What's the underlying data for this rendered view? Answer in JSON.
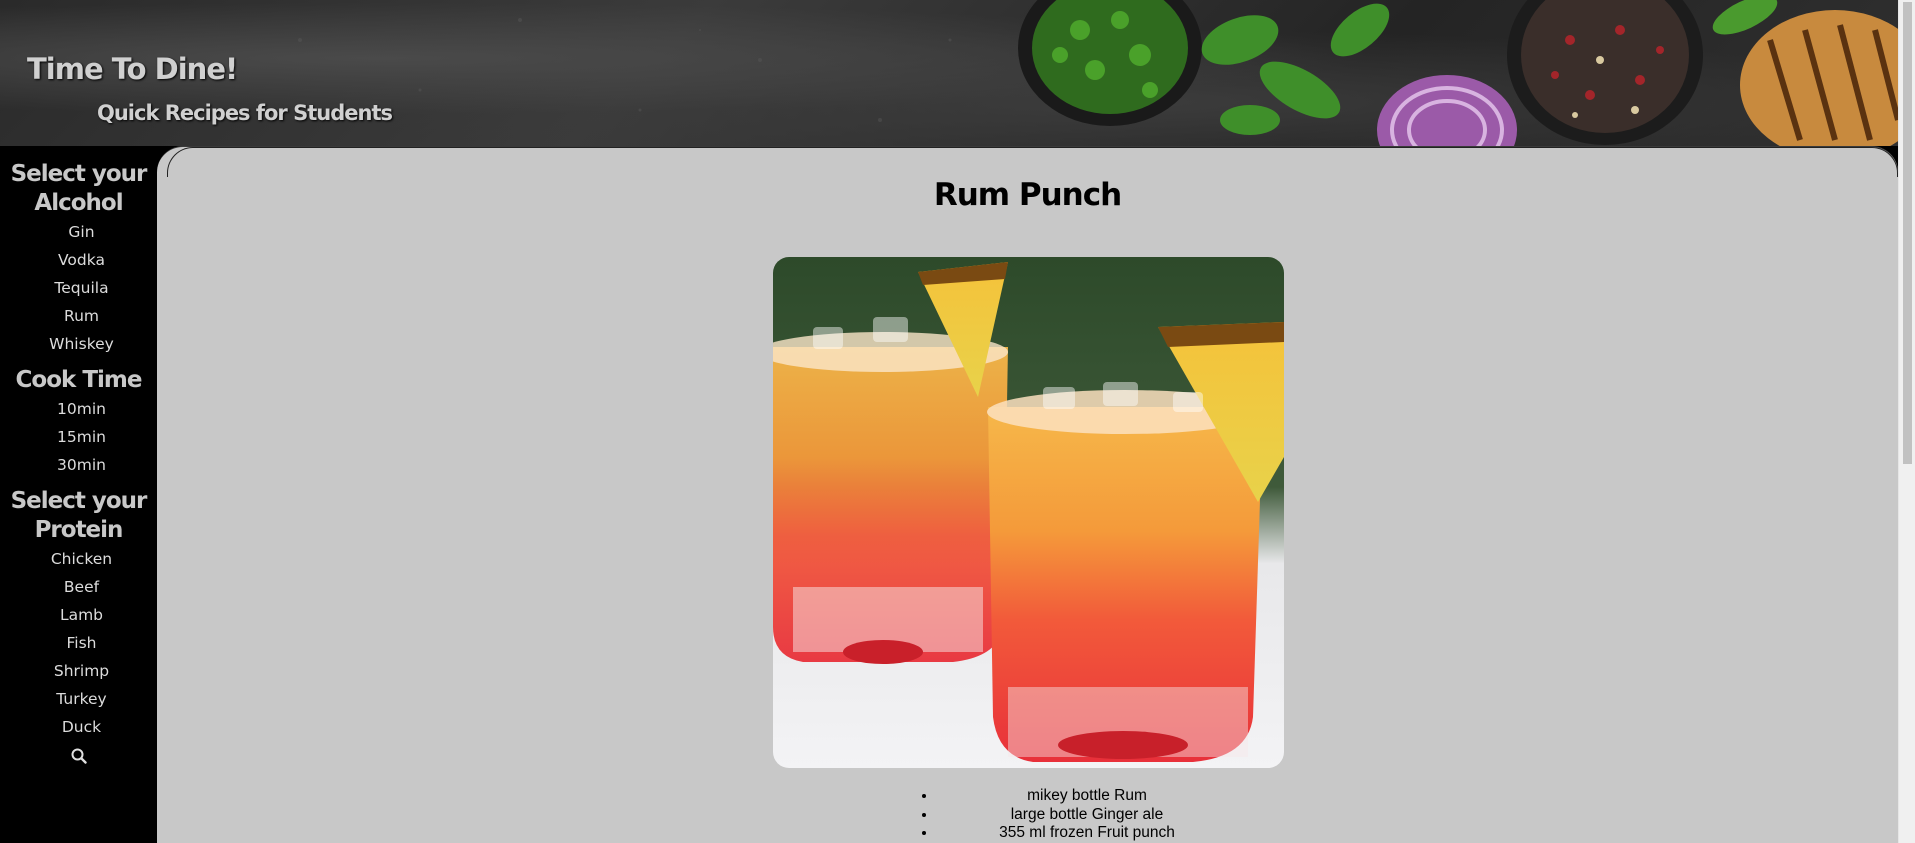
{
  "header": {
    "title": "Time To Dine!",
    "subtitle": "Quick Recipes for Students"
  },
  "sidebar": {
    "groups": [
      {
        "heading": "Select your Alcohol",
        "items": [
          "Gin",
          "Vodka",
          "Tequila",
          "Rum",
          "Whiskey"
        ]
      },
      {
        "heading": "Cook Time",
        "items": [
          "10min",
          "15min",
          "30min"
        ]
      },
      {
        "heading": "Select your Protein",
        "items": [
          "Chicken",
          "Beef",
          "Lamb",
          "Fish",
          "Shrimp",
          "Turkey",
          "Duck"
        ]
      }
    ],
    "search_icon": "search-icon"
  },
  "recipe": {
    "title": "Rum Punch",
    "ingredients": [
      "mikey bottle Rum",
      "large bottle Ginger ale",
      "355 ml frozen Fruit punch"
    ]
  },
  "colors": {
    "content_bg": "#c8c8c8",
    "sidebar_bg": "#000000",
    "heading_text": "#c8c8c8"
  }
}
